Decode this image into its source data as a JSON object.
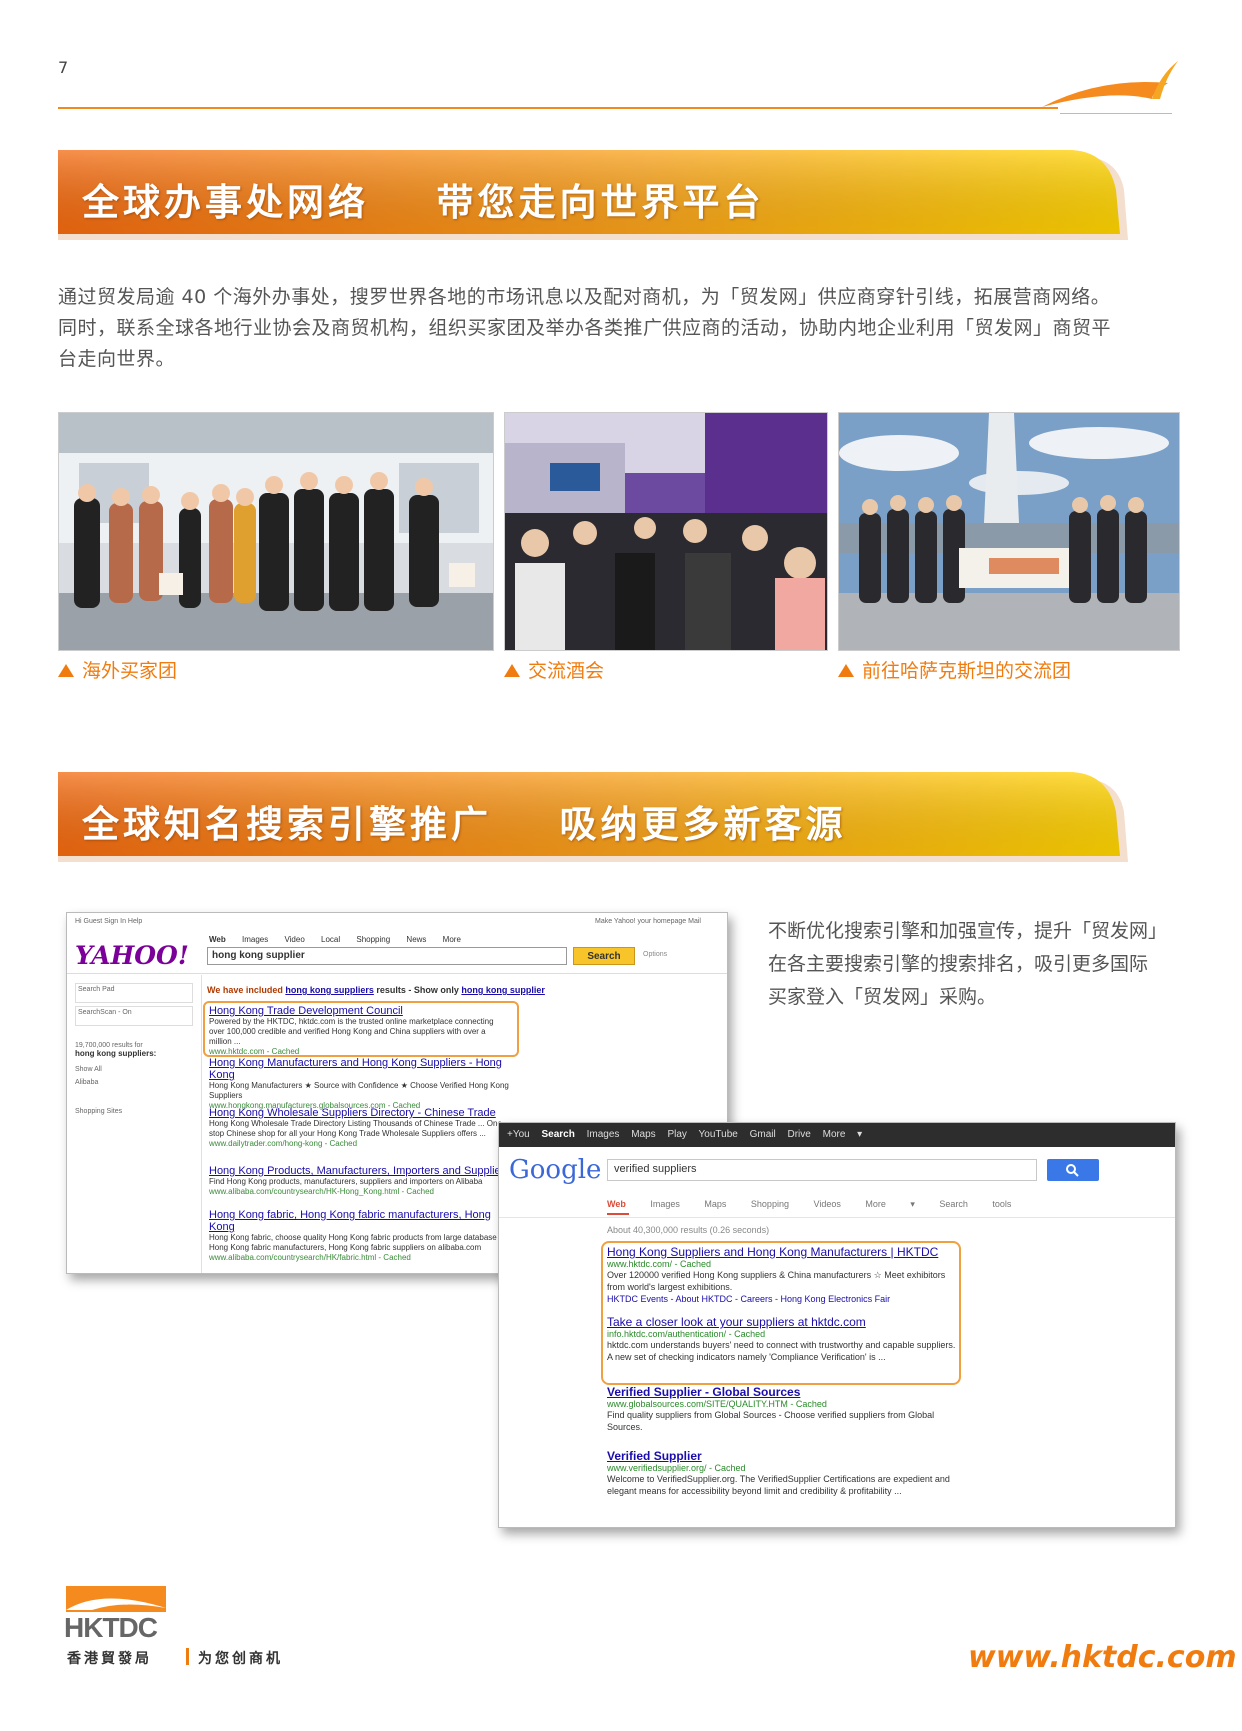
{
  "page": {
    "number": "7"
  },
  "section1": {
    "title": "全球办事处网络    带您走向世界平台"
  },
  "intro": {
    "line1": "通过贸发局逾 40 个海外办事处，搜罗世界各地的市场讯息以及配对商机，为「贸发网」供应商穿针引线，拓展营商网络。",
    "line2": "同时，联系全球各地行业协会及商贸机构，组织买家团及举办各类推广供应商的活动，协助内地企业利用「贸发网」商贸平",
    "line3": "台走向世界。"
  },
  "photos": [
    {
      "caption": "海外买家团"
    },
    {
      "caption": "交流酒会"
    },
    {
      "caption": "前往哈萨克斯坦的交流团"
    }
  ],
  "section2": {
    "title": "全球知名搜索引擎推广    吸纳更多新客源"
  },
  "side_text": {
    "line1": "不断优化搜索引擎和加强宣传，提升「贸发网」",
    "line2": "在各主要搜索引擎的搜索排名，吸引更多国际",
    "line3": "买家登入「贸发网」采购。"
  },
  "yahoo": {
    "top_links": "Hi Guest   Sign In   Help",
    "top_right": "Make Yahoo! your homepage   Mail",
    "logo": "YAHOO!",
    "tabs": [
      "Web",
      "Images",
      "Video",
      "Local",
      "Shopping",
      "News",
      "More"
    ],
    "query": "hong kong supplier",
    "search_button": "Search",
    "options": "Options",
    "side_items": [
      "Search Pad",
      "SearchScan - On"
    ],
    "result_count": "19,700,000 results for",
    "result_query": "hong kong suppliers:",
    "side_filters": [
      "Show All",
      "Alibaba",
      "Shopping Sites"
    ],
    "notice_prefix": "We have included ",
    "notice_link": "hong kong suppliers",
    "notice_mid": " results - Show only ",
    "notice_link2": "hong kong supplier",
    "results": [
      {
        "title": "Hong Kong Trade Development Council",
        "desc": "Powered by the HKTDC, hktdc.com is the trusted online marketplace connecting over 100,000 credible and verified Hong Kong and China suppliers with over a million ...",
        "url": "www.hktdc.com - Cached"
      },
      {
        "title": "Hong Kong Manufacturers and Hong Kong Suppliers - Hong Kong",
        "desc": "Hong Kong Manufacturers ★ Source with Confidence ★ Choose Verified Hong Kong Suppliers",
        "url": "www.hongkong.manufacturers.globalsources.com - Cached"
      },
      {
        "title": "Hong Kong Wholesale Suppliers Directory - Chinese Trade",
        "desc": "Hong Kong Wholesale Trade Directory Listing Thousands of Chinese Trade ... One stop Chinese shop for all your Hong Kong Trade Wholesale Suppliers offers ...",
        "url": "www.dailytrader.com/hong-kong - Cached"
      },
      {
        "title": "Hong Kong Products, Manufacturers, Importers and Suppliers",
        "desc": "Find Hong Kong products, manufacturers, suppliers and importers on Alibaba",
        "url": "www.alibaba.com/countrysearch/HK-Hong_Kong.html - Cached"
      },
      {
        "title": "Hong Kong fabric, Hong Kong fabric manufacturers, Hong Kong",
        "desc": "Hong Kong fabric, choose quality Hong Kong fabric products from large database of Hong Kong fabric manufacturers, Hong Kong fabric suppliers on alibaba.com",
        "url": "www.alibaba.com/countrysearch/HK/fabric.html - Cached"
      }
    ]
  },
  "google": {
    "topbar": [
      "+You",
      "Search",
      "Images",
      "Maps",
      "Play",
      "YouTube",
      "Gmail",
      "Drive",
      "More ▾"
    ],
    "logo": "Google",
    "query": "verified suppliers",
    "tabs": [
      "Web",
      "Images",
      "Maps",
      "Shopping",
      "Videos",
      "More ▾",
      "Search tools"
    ],
    "stats": "About 40,300,000 results (0.26 seconds)",
    "results": [
      {
        "title": "Hong Kong Suppliers and Hong Kong Manufacturers | HKTDC",
        "url": "www.hktdc.com/ - Cached",
        "desc": "Over 120000 verified Hong Kong suppliers & China manufacturers ☆ Meet exhibitors from world's largest exhibitions.",
        "sitelinks": "HKTDC Events - About HKTDC - Careers - Hong Kong Electronics Fair"
      },
      {
        "title": "Take a closer look at your suppliers at hktdc.com",
        "url": "info.hktdc.com/authentication/ - Cached",
        "desc": "hktdc.com understands buyers' need to connect with trustworthy and capable suppliers. A new set of checking indicators namely 'Compliance Verification' is ..."
      },
      {
        "title": "Verified Supplier - Global Sources",
        "url": "www.globalsources.com/SITE/QUALITY.HTM - Cached",
        "desc": "Find quality suppliers from Global Sources - Choose verified suppliers from Global Sources."
      },
      {
        "title": "Verified Supplier",
        "url": "www.verifiedsupplier.org/ - Cached",
        "desc": "Welcome to VerifiedSupplier.org. The VerifiedSupplier Certifications are expedient and elegant means for accessibility beyond limit and credibility & profitability ..."
      }
    ]
  },
  "footer": {
    "logo_text": "HKTDC",
    "logo_cn": "香港貿發局",
    "slogan": "为您创商机",
    "url": "www.hktdc.com"
  },
  "colors": {
    "accent": "#f07c10",
    "banner_light": "#ffd400",
    "link": "#1a0dab"
  }
}
